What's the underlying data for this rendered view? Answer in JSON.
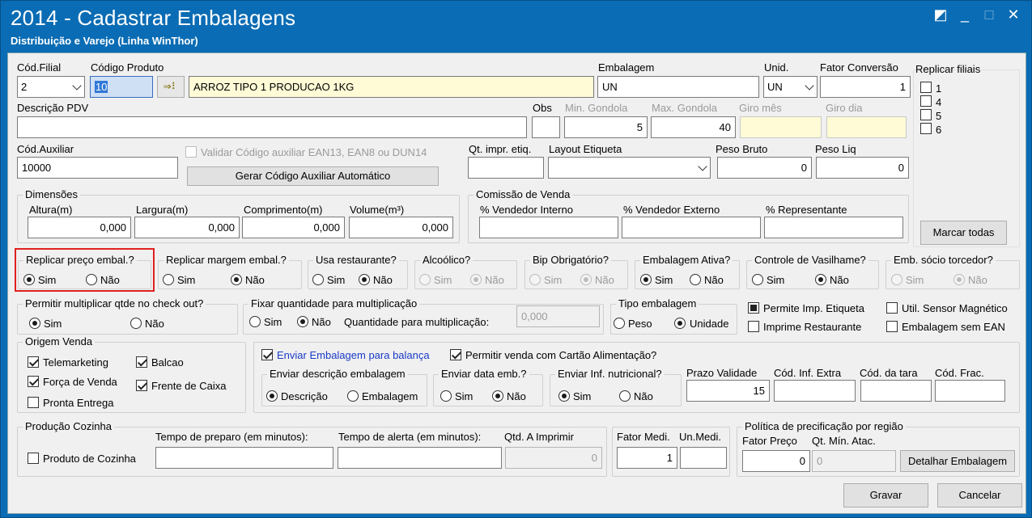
{
  "window": {
    "title": "2014 - Cadastrar Embalagens",
    "subtitle": "Distribuição e Varejo (Linha WinThor)"
  },
  "produto": {
    "cod_filial_label": "Cód.Filial",
    "cod_filial": "2",
    "codigo_label": "Código Produto",
    "codigo": "10",
    "descricao": "ARROZ TIPO 1 PRODUCAO 1KG",
    "embalagem_label": "Embalagem",
    "embalagem": "UN",
    "unid_label": "Unid.",
    "unid": "UN",
    "fator_label": "Fator Conversão",
    "fator": "1"
  },
  "replicar_filiais": {
    "label": "Replicar filiais",
    "items": [
      "1",
      "4",
      "5",
      "6"
    ],
    "marcar_todas": "Marcar todas"
  },
  "pdv": {
    "descricao_label": "Descrição PDV",
    "obs_label": "Obs",
    "min_gondola_label": "Min. Gondola",
    "min_gondola": "5",
    "max_gondola_label": "Max. Gondola",
    "max_gondola": "40",
    "giro_mes_label": "Giro mês",
    "giro_dia_label": "Giro dia"
  },
  "auxiliar": {
    "label": "Cód.Auxiliar",
    "value": "10000",
    "validar_label": "Validar Código auxiliar EAN13, EAN8 ou DUN14",
    "gerar_button": "Gerar Código Auxiliar Automático",
    "qt_impr_label": "Qt. impr. etiq.",
    "layout_label": "Layout Etiqueta",
    "peso_bruto_label": "Peso Bruto",
    "peso_bruto": "0",
    "peso_liq_label": "Peso Liq",
    "peso_liq": "0"
  },
  "dimensoes": {
    "title": "Dimensões",
    "altura_label": "Altura(m)",
    "altura": "0,000",
    "largura_label": "Largura(m)",
    "largura": "0,000",
    "comprimento_label": "Comprimento(m)",
    "comprimento": "0,000",
    "volume_label": "Volume(m³)",
    "volume": "0,000"
  },
  "comissao": {
    "title": "Comissão de Venda",
    "interno_label": "% Vendedor Interno",
    "externo_label": "% Vendedor Externo",
    "representante_label": "% Representante"
  },
  "opt": {
    "sim": "Sim",
    "nao": "Não"
  },
  "radios": {
    "replicar_preco": "Replicar preço embal.?",
    "replicar_margem": "Replicar margem embal.?",
    "usa_restaurante": "Usa restaurante?",
    "alcoolico": "Alcoólico?",
    "bip": "Bip Obrigatório?",
    "ativa": "Embalagem Ativa?",
    "vasilhame": "Controle de Vasilhame?",
    "socio": "Emb. sócio torcedor?"
  },
  "multiplicar": {
    "permitir_label": "Permitir multiplicar qtde no check out?",
    "fixar_label": "Fixar quantidade para multiplicação",
    "qtd_label": "Quantidade para multiplicação:",
    "qtd": "0,000",
    "tipo_label": "Tipo embalagem",
    "peso": "Peso",
    "unidade": "Unidade",
    "permite_imp": "Permite Imp. Etiqueta",
    "util_sensor": "Util. Sensor Magnético",
    "imprime_rest": "Imprime Restaurante",
    "emb_sem_ean": "Embalagem sem EAN"
  },
  "origem": {
    "title": "Origem Venda",
    "telemarketing": "Telemarketing",
    "balcao": "Balcao",
    "forca": "Força de Venda",
    "frente": "Frente de Caixa",
    "pronta": "Pronta Entrega"
  },
  "balanca": {
    "enviar_emb": "Enviar Embalagem para balança",
    "permitir_cartao": "Permitir venda com Cartão Alimentação?",
    "desc_label": "Enviar descrição embalagem",
    "descricao": "Descrição",
    "embalagem": "Embalagem",
    "data_label": "Enviar data emb.?",
    "nutri_label": "Enviar Inf. nutricional?",
    "prazo_label": "Prazo Validade",
    "prazo": "15",
    "inf_extra_label": "Cód. Inf. Extra",
    "tara_label": "Cód. da tara",
    "frac_label": "Cód. Frac."
  },
  "cozinha": {
    "title": "Produção Cozinha",
    "produto": "Produto de Cozinha",
    "tempo_preparo": "Tempo de preparo (em minutos):",
    "tempo_alerta": "Tempo de alerta (em minutos):",
    "qtd_imprimir": "Qtd. A Imprimir",
    "qtd": "0"
  },
  "medida": {
    "fator_label": "Fator Medi.",
    "fator": "1",
    "un_label": "Un.Medi."
  },
  "politica": {
    "title": "Política de precificação por região",
    "fator_label": "Fator Preço",
    "fator": "0",
    "qt_label": "Qt. Mín. Atac.",
    "qt": "0",
    "detalhar": "Detalhar Embalagem"
  },
  "actions": {
    "gravar": "Gravar",
    "cancelar": "Cancelar"
  }
}
